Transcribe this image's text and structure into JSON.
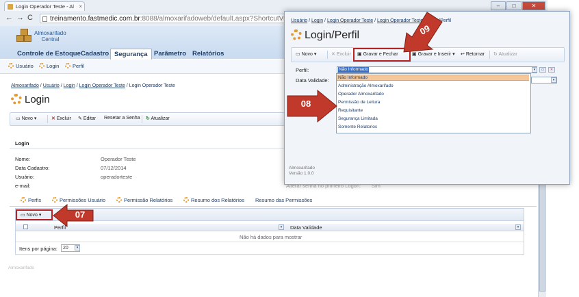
{
  "browser": {
    "tab_title": "Login Operador Teste - Al",
    "url_host": "treinamento.fastmedic.com.br",
    "url_rest": ":8088/almoxarifadoweb/default.aspx?ShortcutViewID=",
    "win_min": "–",
    "win_max": "□",
    "win_close": "✕",
    "back": "←",
    "forward": "→",
    "refresh": "C"
  },
  "app": {
    "title_line1": "Almoxarifado",
    "title_line2": "Central",
    "menu": [
      "Controle de Estoque",
      "Cadastro",
      "Segurança",
      "Parâmetro",
      "Relatórios"
    ],
    "submenu": [
      "Usuário",
      "Login",
      "Perfil"
    ],
    "breadcrumb": [
      "Almoxarifado",
      "Usuário",
      "Login",
      "Login Operador Teste"
    ],
    "breadcrumb_current": "Login Operador Teste",
    "page_title": "Login",
    "toolbar": {
      "novo": "Novo",
      "excluir": "Excluir",
      "editar": "Editar",
      "resetar": "Resetar a Senha",
      "atualizar": "Atualizar"
    },
    "section": "Login",
    "fields": [
      {
        "label": "Nome:",
        "value": "Operador Teste"
      },
      {
        "label": "Data Cadastro:",
        "value": "07/12/2014"
      },
      {
        "label": "Usuário:",
        "value": "operadorteste"
      },
      {
        "label": "e-mail:",
        "value": ""
      }
    ],
    "senha_label": "Alterar senha no primeiro Logon:",
    "senha_value": "Sim",
    "tabs": [
      "Perfis",
      "Permissões Usuário",
      "Permissão Relatórios",
      "Resumo dos Relatórios",
      "Resumo das Permissões"
    ],
    "grid_novo": "Novo",
    "grid_cols": [
      "Perfil",
      "Data Validade"
    ],
    "grid_empty": "Não há dados para mostrar",
    "items_per_page_label": "Itens por página:",
    "items_per_page_value": "20",
    "footer": "Almoxarifado"
  },
  "popup": {
    "breadcrumb": [
      "Usuário",
      "Login",
      "Login Operador Teste",
      "Login Operador Teste",
      "Login/Perfil"
    ],
    "title": "Login/Perfil",
    "toolbar": {
      "novo": "Novo",
      "excluir": "Excluir",
      "gravar_fechar": "Gravar e Fechar",
      "gravar_inserir": "Gravar e Inserir",
      "retornar": "Retornar",
      "atualizar": "Atualizar"
    },
    "perfil_label": "Perfil:",
    "perfil_value": "Não Informado",
    "validade_label": "Data Validade:",
    "options": [
      "Não Informado",
      "Administração Almoxarifado",
      "Operador Almoxarifado",
      "Permissão de Leitura",
      "Requisitante",
      "Segurança Limitada",
      "Somente Relatorios"
    ],
    "footer_line1": "Almoxarifado",
    "footer_line2": "Versão 1.0.0"
  },
  "callouts": {
    "c07": "07",
    "c08": "08",
    "c09": "09"
  },
  "colors": {
    "callout": "#c0392b",
    "accent": "#1f3d66",
    "selected_option": "#f3c79a"
  }
}
